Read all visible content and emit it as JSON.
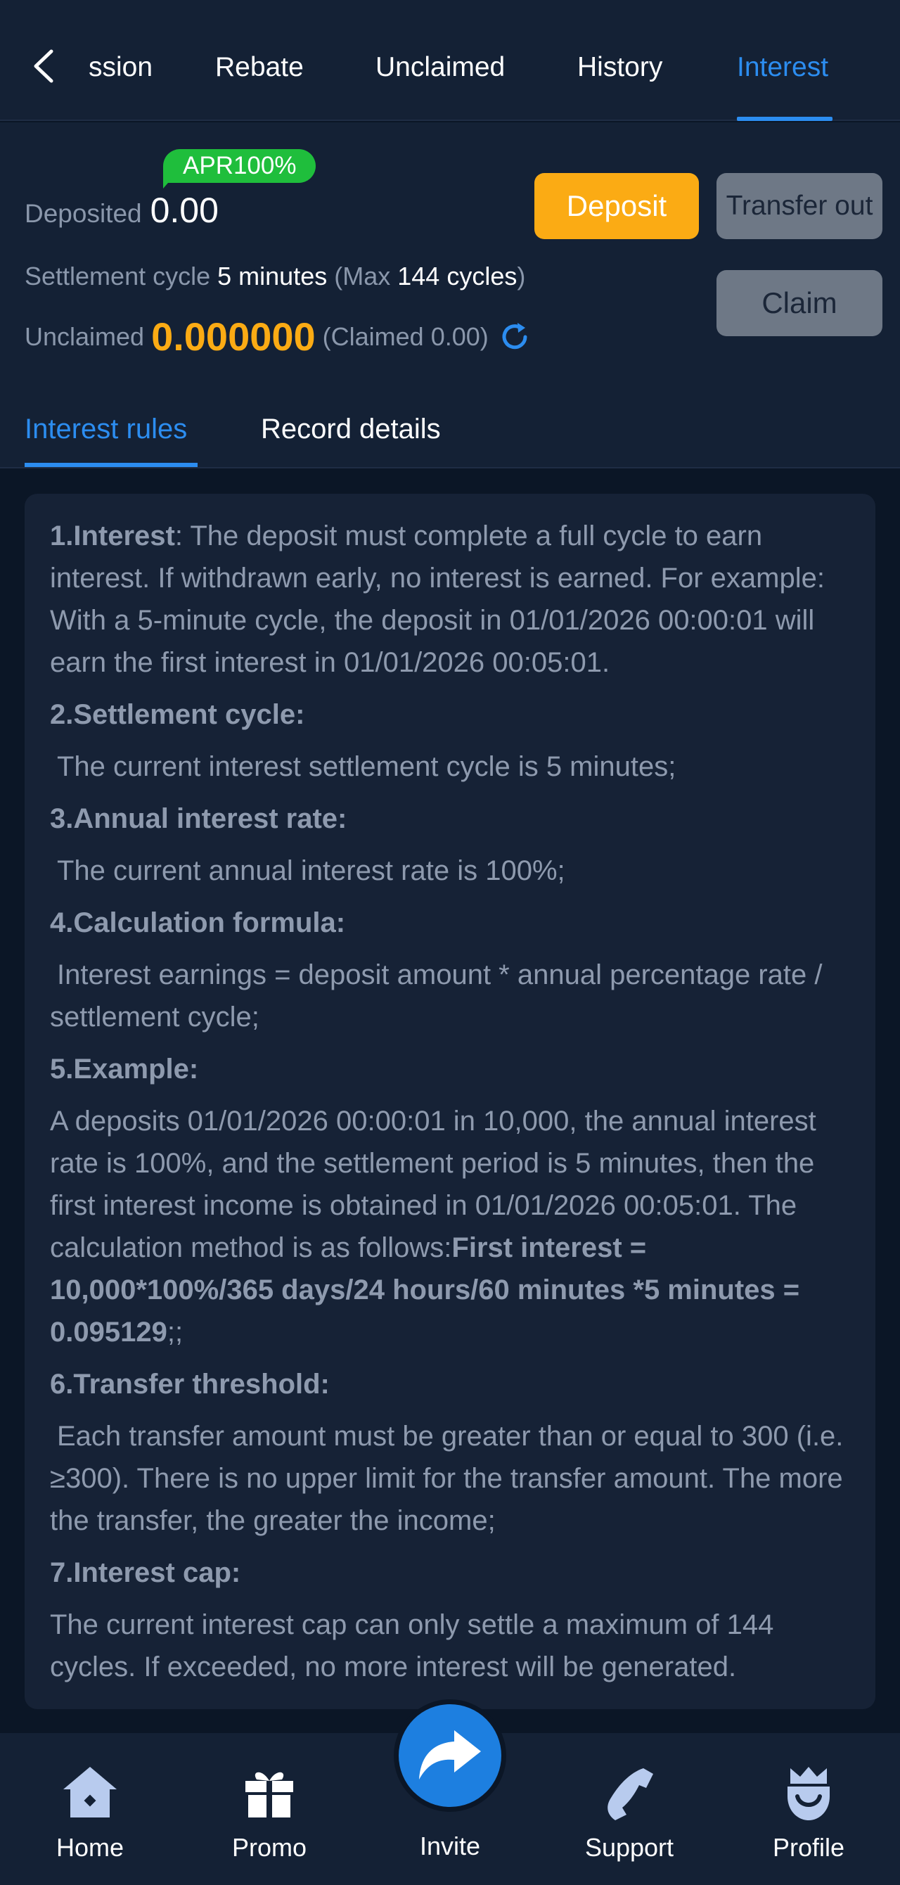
{
  "top_tabs": [
    {
      "label": "ssion"
    },
    {
      "label": "Rebate"
    },
    {
      "label": "Unclaimed"
    },
    {
      "label": "History"
    },
    {
      "label": "Interest"
    }
  ],
  "header": {
    "apr_badge": "APR100%",
    "deposited_label": "Deposited",
    "deposited_value": "0.00",
    "deposit_button": "Deposit",
    "transfer_out_button": "Transfer out",
    "claim_button": "Claim",
    "settlement_label": "Settlement cycle",
    "settlement_value": "5 minutes",
    "max_open": "(Max",
    "max_value": "144 cycles",
    "max_close": ")",
    "unclaimed_label": "Unclaimed",
    "unclaimed_value": "0.000000",
    "claimed_note": "(Claimed 0.00)"
  },
  "sub_tabs": [
    {
      "label": "Interest rules"
    },
    {
      "label": "Record details"
    }
  ],
  "rules": {
    "r1_title": "1.Interest",
    "r1_text": ": The deposit must complete a full cycle to earn interest. If withdrawn early, no interest is earned. For example: With a 5-minute cycle, the deposit in 01/01/2026 00:00:01 will earn the first interest in 01/01/2026 00:05:01.",
    "r2_title": "2.Settlement cycle:",
    "r2_text": "The current interest settlement cycle is 5 minutes;",
    "r3_title": "3.Annual interest rate:",
    "r3_text": "The current annual interest rate is 100%;",
    "r4_title": "4.Calculation formula:",
    "r4_text": "Interest earnings = deposit amount * annual percentage rate / settlement cycle;",
    "r5_title": "5.Example:",
    "r5_text": "A deposits 01/01/2026 00:00:01 in 10,000, the annual interest rate is 100%, and the settlement period is 5 minutes, then the first interest income is obtained in 01/01/2026 00:05:01. The calculation method is as follows:",
    "r5_bold": "First interest = 10,000*100%/365 days/24 hours/60 minutes *5 minutes = 0.095129",
    "r5_tail": ";;",
    "r6_title": "6.Transfer threshold:",
    "r6_text": "Each transfer amount must be greater than or equal to 300 (i.e. ≥300). There is no upper limit for the transfer amount. The more the transfer, the greater the income;",
    "r7_title": "7.Interest cap:",
    "r7_text": "The current interest cap can only settle a maximum of 144 cycles. If exceeded, no more interest will be generated."
  },
  "bottom_nav": [
    {
      "label": "Home"
    },
    {
      "label": "Promo"
    },
    {
      "label": "Invite"
    },
    {
      "label": "Support"
    },
    {
      "label": "Profile"
    }
  ],
  "colors": {
    "accent_blue": "#2c8df0",
    "deposit_orange": "#fbab14",
    "apr_green": "#1fbe3c",
    "background": "#0b1626",
    "panel": "#142135"
  }
}
